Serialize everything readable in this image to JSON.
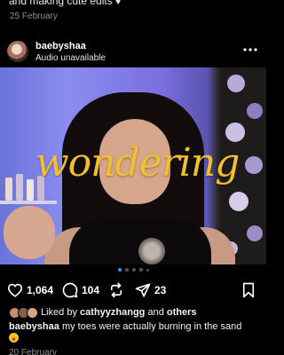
{
  "previous_post": {
    "caption_fragment": "and making cute edits",
    "date": "25 February"
  },
  "post": {
    "username": "baebyshaa",
    "audio_label": "Audio unavailable",
    "overlay_text": "wondering",
    "carousel": {
      "count": 5,
      "active_index": 0
    },
    "likes_count": "1,064",
    "comments_count": "104",
    "shares_count": "23",
    "liked_by_prefix": "Liked by",
    "liked_by_user": "cathyyzhangg",
    "liked_by_and": "and",
    "liked_by_others": "others",
    "caption_user": "baebyshaa",
    "caption_text": "my toes were actually burning in the sand",
    "date": "20 February"
  },
  "icons": {
    "more": "more-dots-icon",
    "like": "heart-icon",
    "comment": "comment-bubble-icon",
    "repost": "repost-icon",
    "share": "paper-plane-icon",
    "save": "bookmark-icon"
  },
  "colors": {
    "background": "#000000",
    "overlay_text": "#f2c02e",
    "active_dot": "#3897f0",
    "muted_text": "#8e8e8e"
  }
}
